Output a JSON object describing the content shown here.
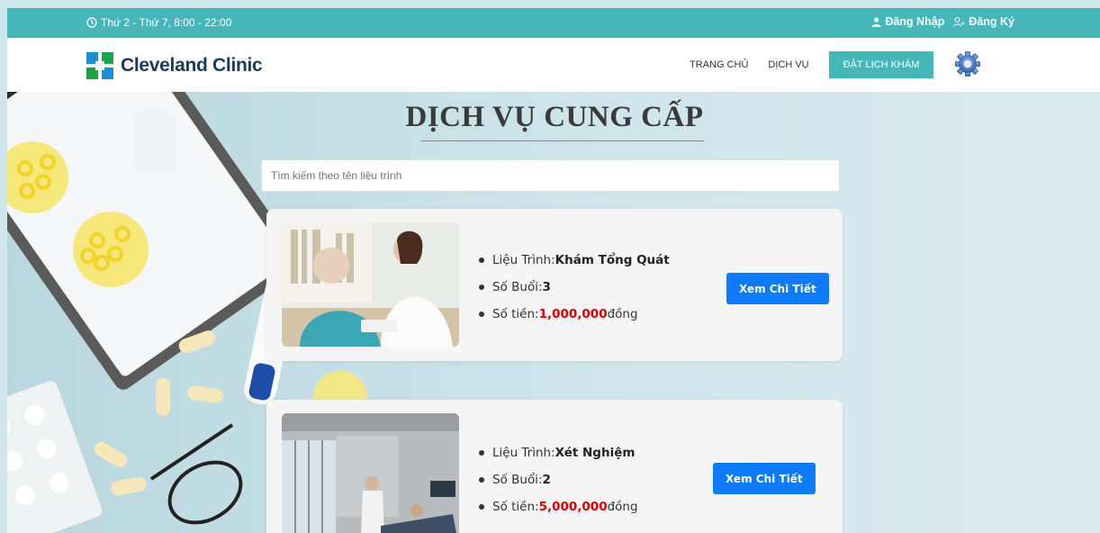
{
  "topbar": {
    "hours": "Thứ 2 - Thứ 7, 8:00 - 22:00",
    "login": "Đăng Nhập",
    "register": "Đăng Ký"
  },
  "navbar": {
    "brand": "Cleveland Clinic",
    "links": [
      "TRANG CHỦ",
      "DỊCH VỤ"
    ],
    "book_button": "ĐẶT LỊCH KHÁM"
  },
  "main": {
    "title": "DỊCH VỤ CUNG CẤP",
    "search_placeholder": "Tìm kiếm theo tên liệu trình",
    "services": [
      {
        "label_course": "Liệu Trình: ",
        "course": "Khám Tổng Quát",
        "label_sessions": "Số Buổi: ",
        "sessions": "3",
        "label_price": "Số tiền: ",
        "price": "1,000,000",
        "currency": " đồng",
        "button": "Xem Chi Tiết"
      },
      {
        "label_course": "Liệu Trình: ",
        "course": "Xét Nghiệm",
        "label_sessions": "Số Buổi: ",
        "sessions": "2",
        "label_price": "Số tiền: ",
        "price": "5,000,000",
        "currency": " đồng",
        "button": "Xem Chi Tiết"
      }
    ]
  },
  "colors": {
    "accent": "#46b7b9",
    "button_blue": "#0d7bff",
    "price_red": "#e00000"
  },
  "icons": [
    "clock-icon",
    "user-icon",
    "user-plus-icon",
    "gear-icon",
    "cleveland-logo-mark"
  ]
}
